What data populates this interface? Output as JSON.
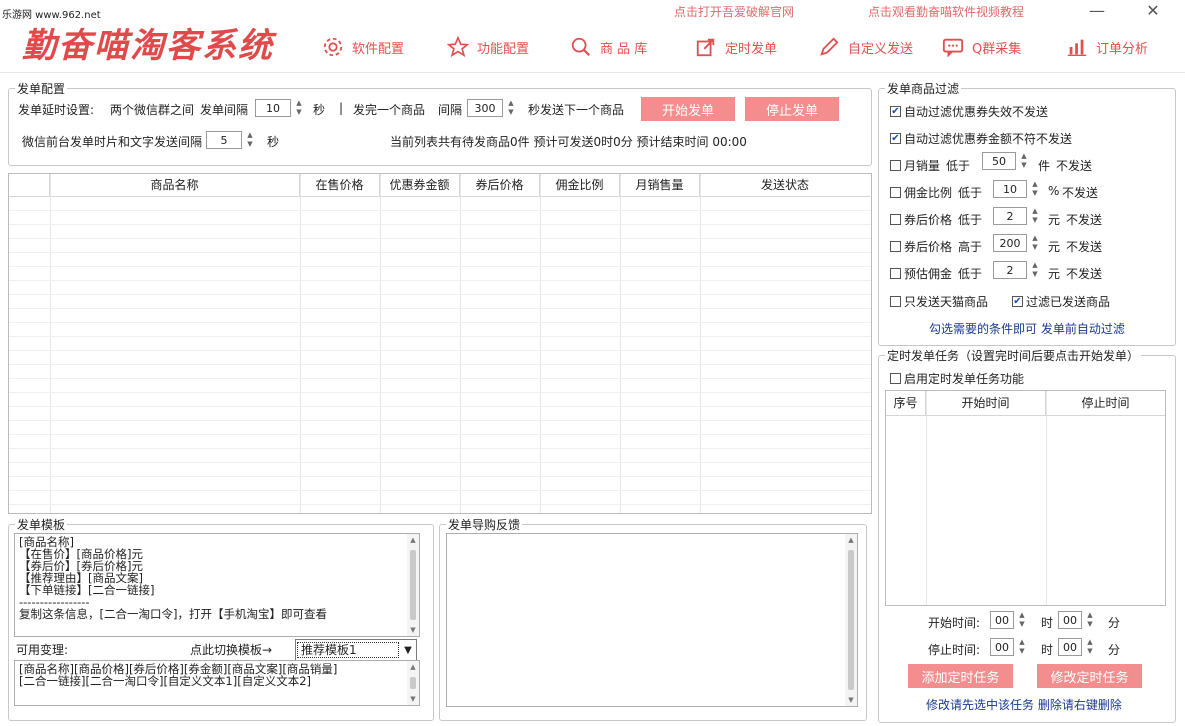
{
  "watermark": "乐游网 www.962.net",
  "app_title": "勤奋喵淘客系统",
  "top_links": {
    "crack_site": "点击打开吾爱破解官网",
    "video_tutorial": "点击观看勤奋喵软件视频教程"
  },
  "nav": [
    {
      "label": "软件配置",
      "icon": "gear-icon"
    },
    {
      "label": "功能配置",
      "icon": "star-icon"
    },
    {
      "label": "商 品 库",
      "icon": "search-icon"
    },
    {
      "label": "定时发单",
      "icon": "share-icon"
    },
    {
      "label": "自定义发送",
      "icon": "pencil-icon"
    },
    {
      "label": "Q群采集",
      "icon": "chat-icon"
    },
    {
      "label": "订单分析",
      "icon": "bar-chart-icon"
    }
  ],
  "send_config": {
    "legend": "发单配置",
    "delay_label": "发单延时设置:",
    "between_groups": "两个微信群之间",
    "interval_label": "发单间隔",
    "interval_value": "10",
    "unit_sec": "秒",
    "separator": "|",
    "after_one": "发完一个商品",
    "gap_label": "间隔",
    "gap_value": "300",
    "gap_suffix": "秒发送下一个商品",
    "start_button": "开始发单",
    "stop_button": "停止发单",
    "img_text_label": "微信前台发单时片和文字发送间隔",
    "img_text_value": "5",
    "status_text": "当前列表共有待发商品0件  预计可发送0时0分  预计结束时间  00:00"
  },
  "product_table": {
    "columns": [
      "",
      "商品名称",
      "在售价格",
      "优惠券金额",
      "券后价格",
      "佣金比例",
      "月销售量",
      "发送状态"
    ]
  },
  "filter": {
    "legend": "发单商品过滤",
    "auto_invalid": {
      "label": "自动过滤优惠券失效不发送",
      "checked": true
    },
    "auto_mismatch": {
      "label": "自动过滤优惠券金额不符不发送",
      "checked": true
    },
    "rows": [
      {
        "label": "月销量",
        "cmp": "低于",
        "value": "50",
        "unit": "件",
        "tail": "不发送",
        "checked": false
      },
      {
        "label": "佣金比例",
        "cmp": "低于",
        "value": "10",
        "unit": "%",
        "tail": "不发送",
        "checked": false
      },
      {
        "label": "券后价格",
        "cmp": "低于",
        "value": "2",
        "unit": "元",
        "tail": "不发送",
        "checked": false
      },
      {
        "label": "券后价格",
        "cmp": "高于",
        "value": "200",
        "unit": "元",
        "tail": "不发送",
        "checked": false
      },
      {
        "label": "预估佣金",
        "cmp": "低于",
        "value": "2",
        "unit": "元",
        "tail": "不发送",
        "checked": false
      }
    ],
    "tmall_only": {
      "label": "只发送天猫商品",
      "checked": false
    },
    "skip_sent": {
      "label": "过滤已发送商品",
      "checked": true
    },
    "hint": "勾选需要的条件即可  发单前自动过滤"
  },
  "timer": {
    "legend": "定时发单任务（设置完时间后要点击开始发单）",
    "enable": {
      "label": "启用定时发单任务功能",
      "checked": false
    },
    "columns": [
      "序号",
      "开始时间",
      "停止时间"
    ],
    "start_label": "开始时间:",
    "stop_label": "停止时间:",
    "hour": "时",
    "minute": "分",
    "start_h": "00",
    "start_m": "00",
    "stop_h": "00",
    "stop_m": "00",
    "add_button": "添加定时任务",
    "edit_button": "修改定时任务",
    "footer_hint": "修改请先选中该任务  删除请右键删除"
  },
  "template": {
    "legend": "发单模板",
    "content": "[商品名称]\n【在售价】[商品价格]元\n【券后价】[券后价格]元\n【推荐理由】[商品文案]\n【下单链接】[二合一链接]\n-----------------\n复制这条信息，[二合一淘口令]，打开【手机淘宝】即可查看",
    "vars_label": "可用变理:",
    "switch_label": "点此切换模板→",
    "template_select": "推荐模板1",
    "vars_content": "[商品名称][商品价格][券后价格][券金额][商品文案][商品销量]\n[二合一链接][二合一淘口令][自定义文本1][自定义文本2]"
  },
  "feedback": {
    "legend": "发单导购反馈"
  },
  "colors": {
    "accent": "#e05050",
    "button_pink": "#f48e8e"
  }
}
